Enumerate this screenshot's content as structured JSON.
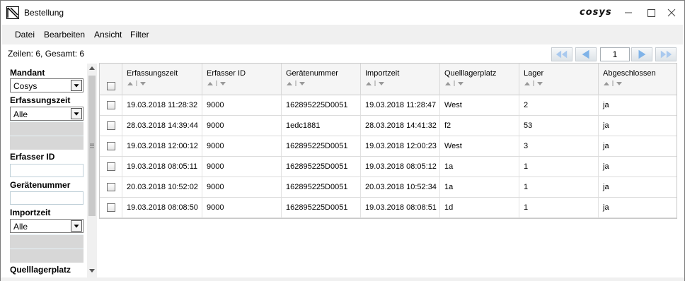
{
  "window": {
    "title": "Bestellung",
    "brand": "cosys",
    "icons": [
      "app-icon",
      "minimize-icon",
      "maximize-icon",
      "close-icon"
    ]
  },
  "menu": [
    "Datei",
    "Bearbeiten",
    "Ansicht",
    "Filter"
  ],
  "summary": "Zeilen: 6, Gesamt: 6",
  "pager": {
    "page": "1",
    "icons": [
      "first-page-icon",
      "previous-page-icon",
      "next-page-icon",
      "last-page-icon"
    ]
  },
  "filters": {
    "mandant": {
      "label": "Mandant",
      "value": "Cosys"
    },
    "erfassungszeit": {
      "label": "Erfassungszeit",
      "value": "Alle"
    },
    "erfasser_id": {
      "label": "Erfasser ID",
      "value": ""
    },
    "geraetenummer": {
      "label": "Gerätenummer",
      "value": ""
    },
    "importzeit": {
      "label": "Importzeit",
      "value": "Alle"
    },
    "quelllagerplatz": {
      "label": "Quelllagerplatz"
    }
  },
  "grid": {
    "columns": [
      "Erfassungszeit",
      "Erfasser ID",
      "Gerätenummer",
      "Importzeit",
      "Quelllagerplatz",
      "Lager",
      "Abgeschlossen"
    ],
    "rows": [
      [
        "19.03.2018 11:28:32",
        "9000",
        "162895225D0051",
        "19.03.2018 11:28:47",
        "West",
        "2",
        "ja"
      ],
      [
        "28.03.2018 14:39:44",
        "9000",
        "1edc1881",
        "28.03.2018 14:41:32",
        "f2",
        "53",
        "ja"
      ],
      [
        "19.03.2018 12:00:12",
        "9000",
        "162895225D0051",
        "19.03.2018 12:00:23",
        "West",
        "3",
        "ja"
      ],
      [
        "19.03.2018 08:05:11",
        "9000",
        "162895225D0051",
        "19.03.2018 08:05:12",
        "1a",
        "1",
        "ja"
      ],
      [
        "20.03.2018 10:52:02",
        "9000",
        "162895225D0051",
        "20.03.2018 10:52:34",
        "1a",
        "1",
        "ja"
      ],
      [
        "19.03.2018 08:08:50",
        "9000",
        "162895225D0051",
        "19.03.2018 08:08:51",
        "1d",
        "1",
        "ja"
      ]
    ]
  },
  "colors": {
    "menubar": "#f0f0f0",
    "pager_arrow": "#7fb3e8",
    "grid_header": "#f5f5f5"
  }
}
